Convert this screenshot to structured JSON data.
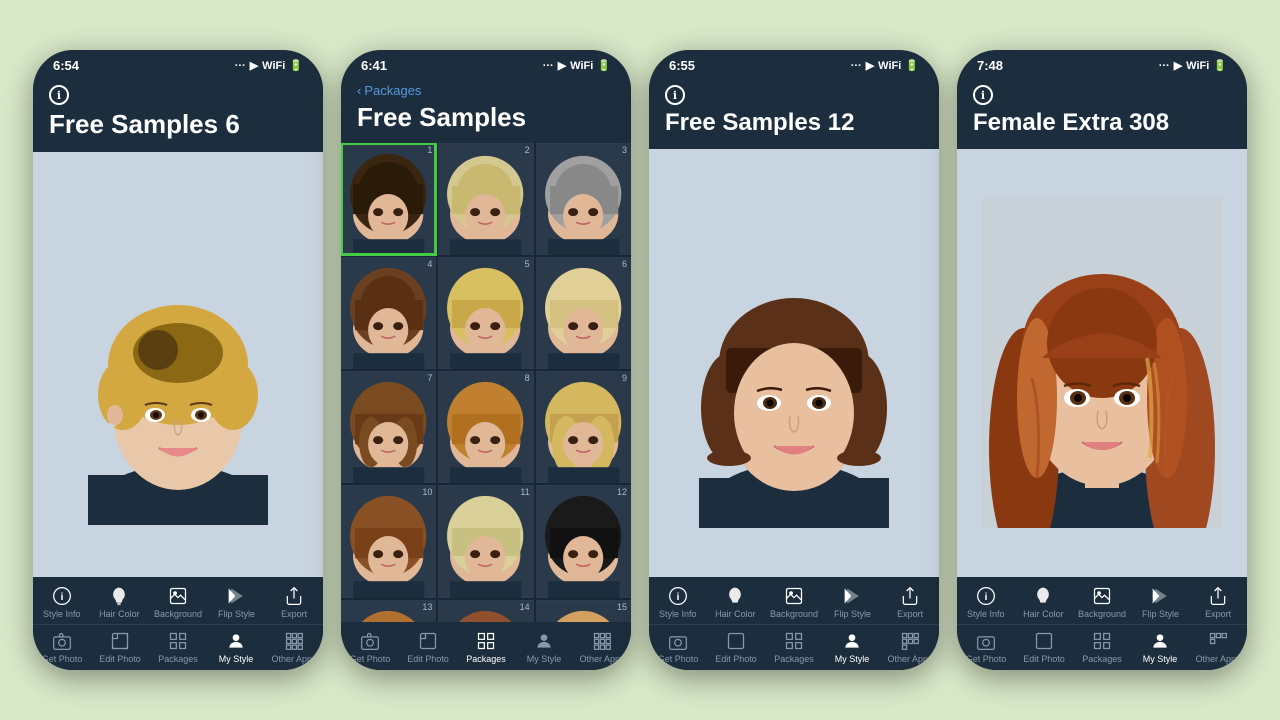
{
  "background_color": "#d8e8c8",
  "phones": [
    {
      "id": "phone1",
      "time": "6:54",
      "header_title": "Free Samples 6",
      "header_info_icon": "ℹ",
      "active_tab": "My Style",
      "toolbar_top": [
        {
          "id": "style-info",
          "label": "Style Info",
          "icon": "info"
        },
        {
          "id": "hair-color",
          "label": "Hair Color",
          "icon": "bucket"
        },
        {
          "id": "background",
          "label": "Background",
          "icon": "photo"
        },
        {
          "id": "flip-style",
          "label": "Flip Style",
          "icon": "flip"
        },
        {
          "id": "export",
          "label": "Export",
          "icon": "share"
        }
      ],
      "toolbar_bottom": [
        {
          "id": "get-photo",
          "label": "Get Photo",
          "icon": "camera",
          "active": false
        },
        {
          "id": "edit-photo",
          "label": "Edit Photo",
          "icon": "edit",
          "active": false
        },
        {
          "id": "packages",
          "label": "Packages",
          "icon": "grid",
          "active": false
        },
        {
          "id": "my-style",
          "label": "My Style",
          "icon": "person",
          "active": true
        },
        {
          "id": "other-apps",
          "label": "Other Apps",
          "icon": "apps",
          "active": false
        }
      ],
      "hair_color": "blonde_short",
      "description": "Blonde short pixie cut woman"
    },
    {
      "id": "phone2",
      "time": "6:41",
      "back_label": "Packages",
      "header_title": "Free Samples",
      "active_tab": "Packages",
      "toolbar_top": [
        {
          "id": "style-info",
          "label": "Style Info",
          "icon": "info"
        },
        {
          "id": "hair-color",
          "label": "Hair Color",
          "icon": "bucket"
        },
        {
          "id": "background",
          "label": "Background",
          "icon": "photo"
        },
        {
          "id": "flip-style",
          "label": "Flip Style",
          "icon": "flip"
        },
        {
          "id": "export",
          "label": "Export",
          "icon": "share"
        }
      ],
      "toolbar_bottom": [
        {
          "id": "get-photo",
          "label": "Get Photo",
          "icon": "camera",
          "active": false
        },
        {
          "id": "edit-photo",
          "label": "Edit Photo",
          "icon": "edit",
          "active": false
        },
        {
          "id": "packages",
          "label": "Packages",
          "icon": "grid",
          "active": true
        },
        {
          "id": "my-style",
          "label": "My Style",
          "icon": "person",
          "active": false
        },
        {
          "id": "other-apps",
          "label": "Other Apps",
          "icon": "apps",
          "active": false
        }
      ],
      "grid_items": [
        {
          "num": 1,
          "selected": true
        },
        {
          "num": 2,
          "selected": false
        },
        {
          "num": 3,
          "selected": false
        },
        {
          "num": 4,
          "selected": false
        },
        {
          "num": 5,
          "selected": false
        },
        {
          "num": 6,
          "selected": false
        },
        {
          "num": 7,
          "selected": false
        },
        {
          "num": 8,
          "selected": false
        },
        {
          "num": 9,
          "selected": false
        },
        {
          "num": 10,
          "selected": false
        },
        {
          "num": 11,
          "selected": false
        },
        {
          "num": 12,
          "selected": false
        },
        {
          "num": 13,
          "selected": false
        },
        {
          "num": 14,
          "selected": false
        },
        {
          "num": 15,
          "selected": false
        }
      ]
    },
    {
      "id": "phone3",
      "time": "6:55",
      "header_title": "Free Samples 12",
      "active_tab": "My Style",
      "toolbar_top": [
        {
          "id": "style-info",
          "label": "Style Info",
          "icon": "info"
        },
        {
          "id": "hair-color",
          "label": "Hair Color",
          "icon": "bucket"
        },
        {
          "id": "background",
          "label": "Background",
          "icon": "photo"
        },
        {
          "id": "flip-style",
          "label": "Flip Style",
          "icon": "flip"
        },
        {
          "id": "export",
          "label": "Export",
          "icon": "share"
        }
      ],
      "toolbar_bottom": [
        {
          "id": "get-photo",
          "label": "Get Photo",
          "icon": "camera",
          "active": false
        },
        {
          "id": "edit-photo",
          "label": "Edit Photo",
          "icon": "edit",
          "active": false
        },
        {
          "id": "packages",
          "label": "Packages",
          "icon": "grid",
          "active": false
        },
        {
          "id": "my-style",
          "label": "My Style",
          "icon": "person",
          "active": true
        },
        {
          "id": "other-apps",
          "label": "Other Apps",
          "icon": "apps",
          "active": false
        }
      ],
      "hair_color": "brown_bob",
      "description": "Dark bob cut with bangs"
    },
    {
      "id": "phone4",
      "time": "7:48",
      "header_title": "Female Extra 308",
      "active_tab": "My Style",
      "toolbar_top": [
        {
          "id": "style-info",
          "label": "Style Info",
          "icon": "info"
        },
        {
          "id": "hair-color",
          "label": "Hair Color",
          "icon": "bucket"
        },
        {
          "id": "background",
          "label": "Background",
          "icon": "photo"
        },
        {
          "id": "flip-style",
          "label": "Flip Style",
          "icon": "flip"
        },
        {
          "id": "export",
          "label": "Export",
          "icon": "share"
        }
      ],
      "toolbar_bottom": [
        {
          "id": "get-photo",
          "label": "Get Photo",
          "icon": "camera",
          "active": false
        },
        {
          "id": "edit-photo",
          "label": "Edit Photo",
          "icon": "edit",
          "active": false
        },
        {
          "id": "packages",
          "label": "Packages",
          "icon": "grid",
          "active": false
        },
        {
          "id": "my-style",
          "label": "My Style",
          "icon": "person",
          "active": true
        },
        {
          "id": "other-apps",
          "label": "Other Apps",
          "icon": "apps",
          "active": false
        }
      ],
      "hair_color": "auburn_long",
      "description": "Long auburn/reddish-brown hair"
    }
  ],
  "icons": {
    "info": "ℹ",
    "bucket": "🪣",
    "share": "↗",
    "camera": "📷",
    "person": "👤",
    "apps": "⊞"
  }
}
